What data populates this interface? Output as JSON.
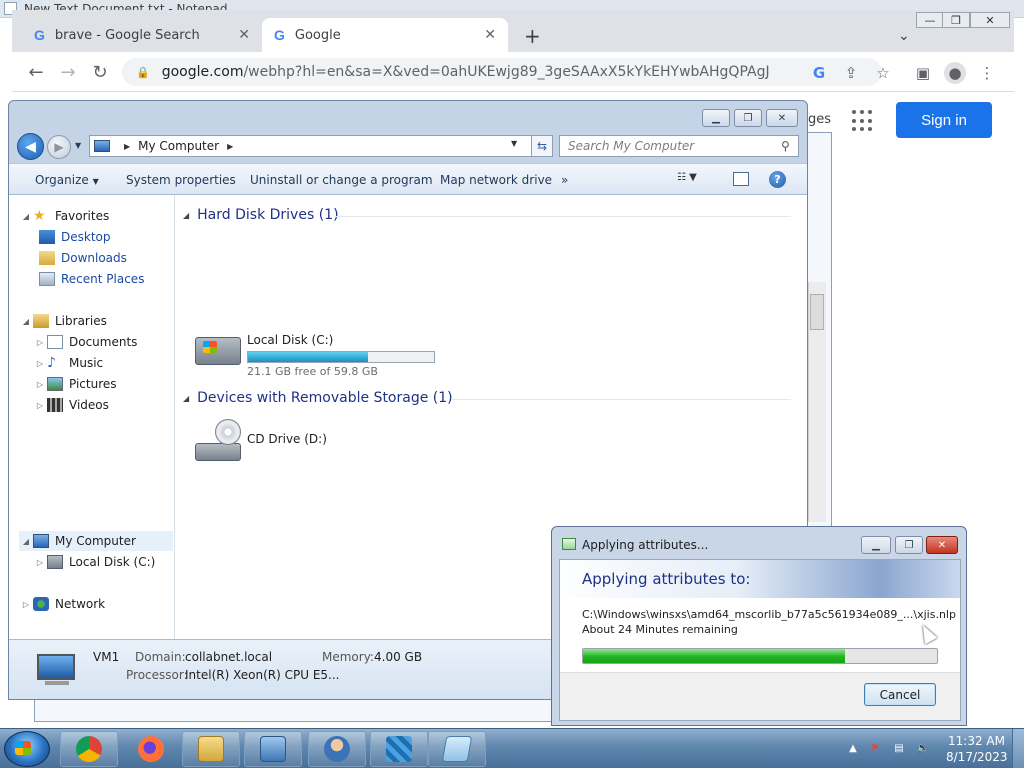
{
  "notepad": {
    "title": "New Text Document.txt - Notepad"
  },
  "chrome": {
    "tabs": [
      {
        "label": "brave - Google Search"
      },
      {
        "label": "Google"
      }
    ],
    "url_host": "google.com",
    "url_path": "/webhp?hl=en&sa=X&ved=0ahUKEwjg89_3geSAAxX5kYkEHYwbAHgQPAgJ"
  },
  "google": {
    "sign_in": "Sign in",
    "partial_link": "ges"
  },
  "explorer": {
    "address": "My Computer",
    "search_placeholder": "Search My Computer",
    "commands": {
      "organize": "Organize",
      "system_properties": "System properties",
      "uninstall": "Uninstall or change a program",
      "map_drive": "Map network drive",
      "more": "»"
    },
    "nav": {
      "favorites": "Favorites",
      "desktop": "Desktop",
      "downloads": "Downloads",
      "recent_places": "Recent Places",
      "libraries": "Libraries",
      "documents": "Documents",
      "music": "Music",
      "pictures": "Pictures",
      "videos": "Videos",
      "my_computer": "My Computer",
      "local_disk": "Local Disk (C:)",
      "network": "Network"
    },
    "groups": {
      "hdd": "Hard Disk Drives (1)",
      "removable": "Devices with Removable Storage (1)"
    },
    "drives": {
      "c_name": "Local Disk (C:)",
      "c_free": "21.1 GB free of 59.8 GB",
      "c_used_fraction": 0.647,
      "d_name": "CD Drive (D:)"
    },
    "details": {
      "computer_name": "VM1",
      "domain_label": "Domain:",
      "domain_value": "collabnet.local",
      "memory_label": "Memory:",
      "memory_value": "4.00 GB",
      "processor_label": "Processor:",
      "processor_value": "Intel(R) Xeon(R) CPU E5..."
    }
  },
  "dialog": {
    "title": "Applying attributes...",
    "heading": "Applying attributes to:",
    "path": "C:\\Windows\\winsxs\\amd64_mscorlib_b77a5c561934e089_...\\xjis.nlp",
    "remaining": "About 24 Minutes remaining",
    "progress_fraction": 0.74,
    "cancel": "Cancel"
  },
  "taskbar": {
    "time": "11:32 AM",
    "date": "8/17/2023"
  },
  "colors": {
    "accent_blue": "#1a73e8",
    "progress_green": "#22b422",
    "disk_bar": "#1d8fc2"
  }
}
